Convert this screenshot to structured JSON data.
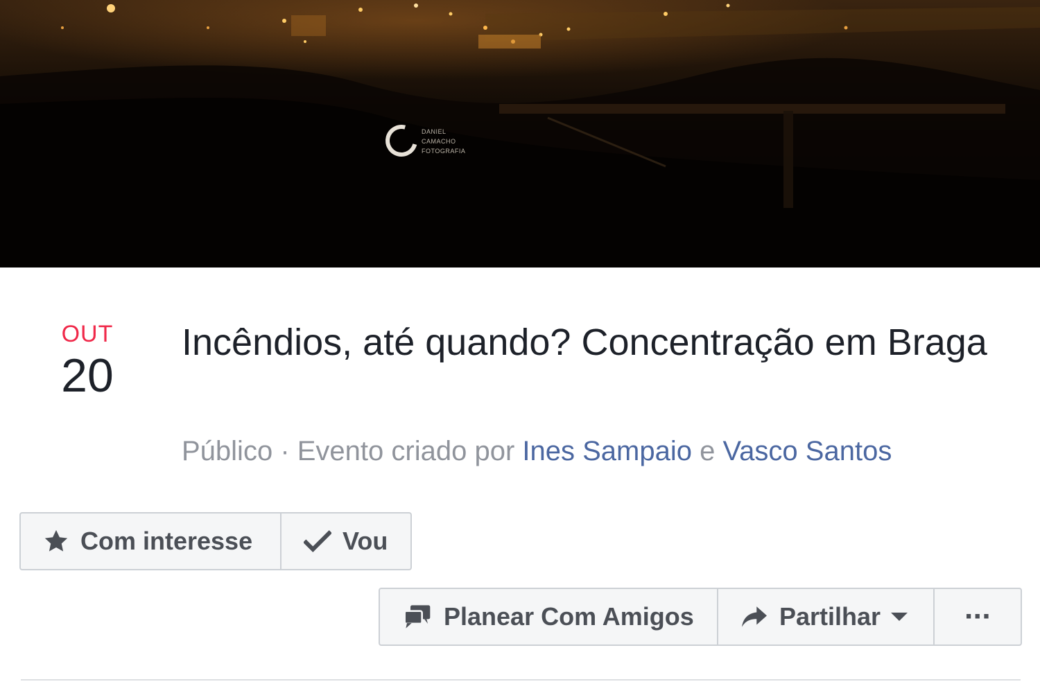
{
  "cover": {
    "logo_text": "DANIEL\nCAMACHO\nFOTOGRAFIA"
  },
  "event": {
    "month": "OUT",
    "day": "20",
    "title": "Incêndios, até quando? Concentração em Braga",
    "privacy": "Público",
    "separator": " · ",
    "created_by_text": "Evento criado por ",
    "creator_1": "Ines Sampaio",
    "conjunction": " e ",
    "creator_2": "Vasco Santos"
  },
  "rsvp": {
    "interested_label": "Com interesse",
    "interested_icon": "star-icon",
    "going_label": "Vou",
    "going_icon": "checkmark-icon"
  },
  "actions": {
    "plan_label": "Planear Com Amigos",
    "plan_icon": "chat-bubbles-icon",
    "share_label": "Partilhar",
    "share_icon": "share-arrow-icon",
    "more_label": "···",
    "more_icon": "more-dots-icon"
  },
  "colors": {
    "month_red": "#f02849",
    "link_blue": "#4b67a1",
    "meta_gray": "#90949c",
    "button_text": "#4b4f56"
  }
}
